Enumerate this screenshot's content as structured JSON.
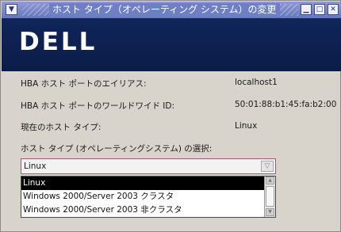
{
  "window": {
    "title": "ホスト タイプ（オペレーティング システム）の変更"
  },
  "banner": {
    "logo_text": "DELL"
  },
  "fields": [
    {
      "label": "HBA ホスト ポートのエイリアス:",
      "value": "localhost1"
    },
    {
      "label": "HBA ホスト ポートのワールドワイド ID:",
      "value": "50:01:88:b1:45:fa:b2:00"
    },
    {
      "label": "現在のホスト タイプ:",
      "value": "Linux"
    }
  ],
  "select_prompt": "ホスト タイプ (オペレーティングシステム) の選択:",
  "host_type_select": {
    "selected": "Linux",
    "options": [
      "Linux",
      "Windows 2000/Server 2003 クラスタ",
      "Windows 2000/Server 2003 非クラスタ"
    ]
  }
}
